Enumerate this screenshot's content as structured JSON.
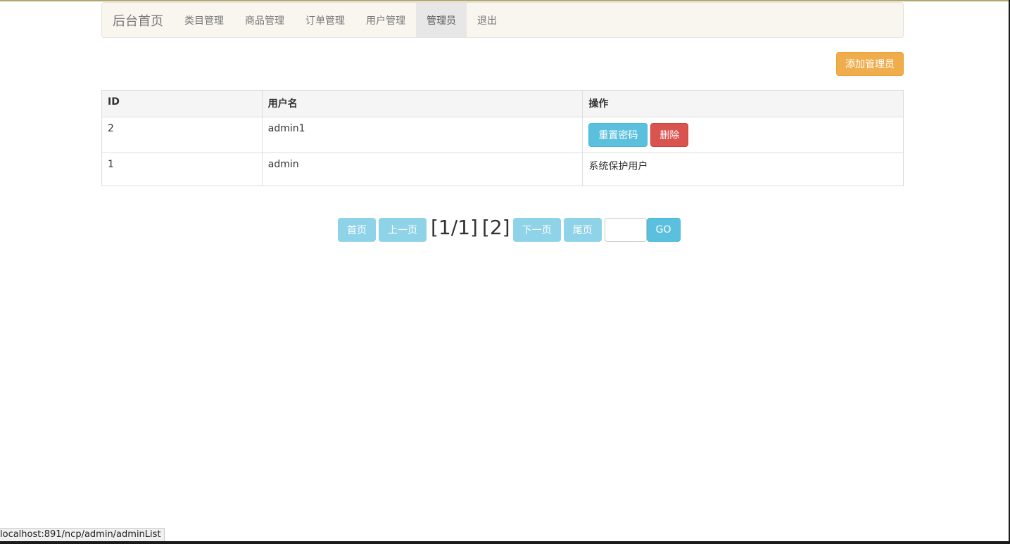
{
  "navbar": {
    "brand": "后台首页",
    "items": [
      {
        "label": "类目管理"
      },
      {
        "label": "商品管理"
      },
      {
        "label": "订单管理"
      },
      {
        "label": "用户管理"
      },
      {
        "label": "管理员"
      },
      {
        "label": "退出"
      }
    ],
    "active_item": "管理员"
  },
  "toolbar": {
    "add_admin_label": "添加管理员"
  },
  "table": {
    "headers": [
      "ID",
      "用户名",
      "操作"
    ],
    "rows": [
      {
        "id": "2",
        "username": "admin1",
        "actions": {
          "reset_label": "重置密码",
          "delete_label": "删除"
        }
      },
      {
        "id": "1",
        "username": "admin",
        "note": "系统保护用户"
      }
    ]
  },
  "pagination": {
    "first_label": "首页",
    "prev_label": "上一页",
    "page_info": "[1/1]",
    "total_info": "[2]",
    "next_label": "下一页",
    "last_label": "尾页",
    "page_input_value": "",
    "go_label": "GO"
  },
  "status_bar": {
    "url": "localhost:891/ncp/admin/adminList"
  },
  "colors": {
    "navbar_bg": "#f9f6ef",
    "warning": "#f0ad4e",
    "info": "#5bc0de",
    "danger": "#d9534f",
    "pager_disabled": "#8fd3e8"
  }
}
